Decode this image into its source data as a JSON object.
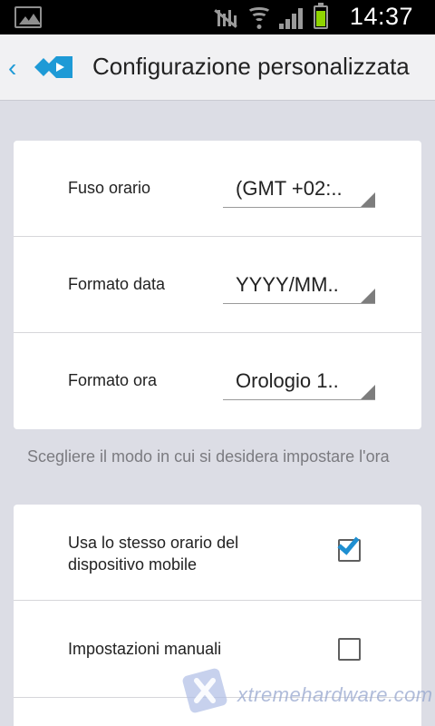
{
  "status_bar": {
    "time": "14:37",
    "icons": [
      "gallery-icon",
      "mute-icon",
      "wifi-icon",
      "signal-icon",
      "battery-icon"
    ],
    "battery_color": "#8fd400"
  },
  "header": {
    "title": "Configurazione personalizzata",
    "accent": "#1e9ad6"
  },
  "time_settings": [
    {
      "label": "Fuso orario",
      "value": "(GMT +02:.."
    },
    {
      "label": "Formato data",
      "value": "YYYY/MM.."
    },
    {
      "label": "Formato ora",
      "value": "Orologio 1.."
    }
  ],
  "note": "Scegliere il modo in cui si desidera impostare l'ora",
  "time_mode": [
    {
      "label": "Usa lo stesso orario del dispositivo mobile",
      "checked": true
    },
    {
      "label": "Impostazioni manuali",
      "checked": false
    }
  ],
  "watermark": {
    "text": "xtremehardware.com"
  }
}
